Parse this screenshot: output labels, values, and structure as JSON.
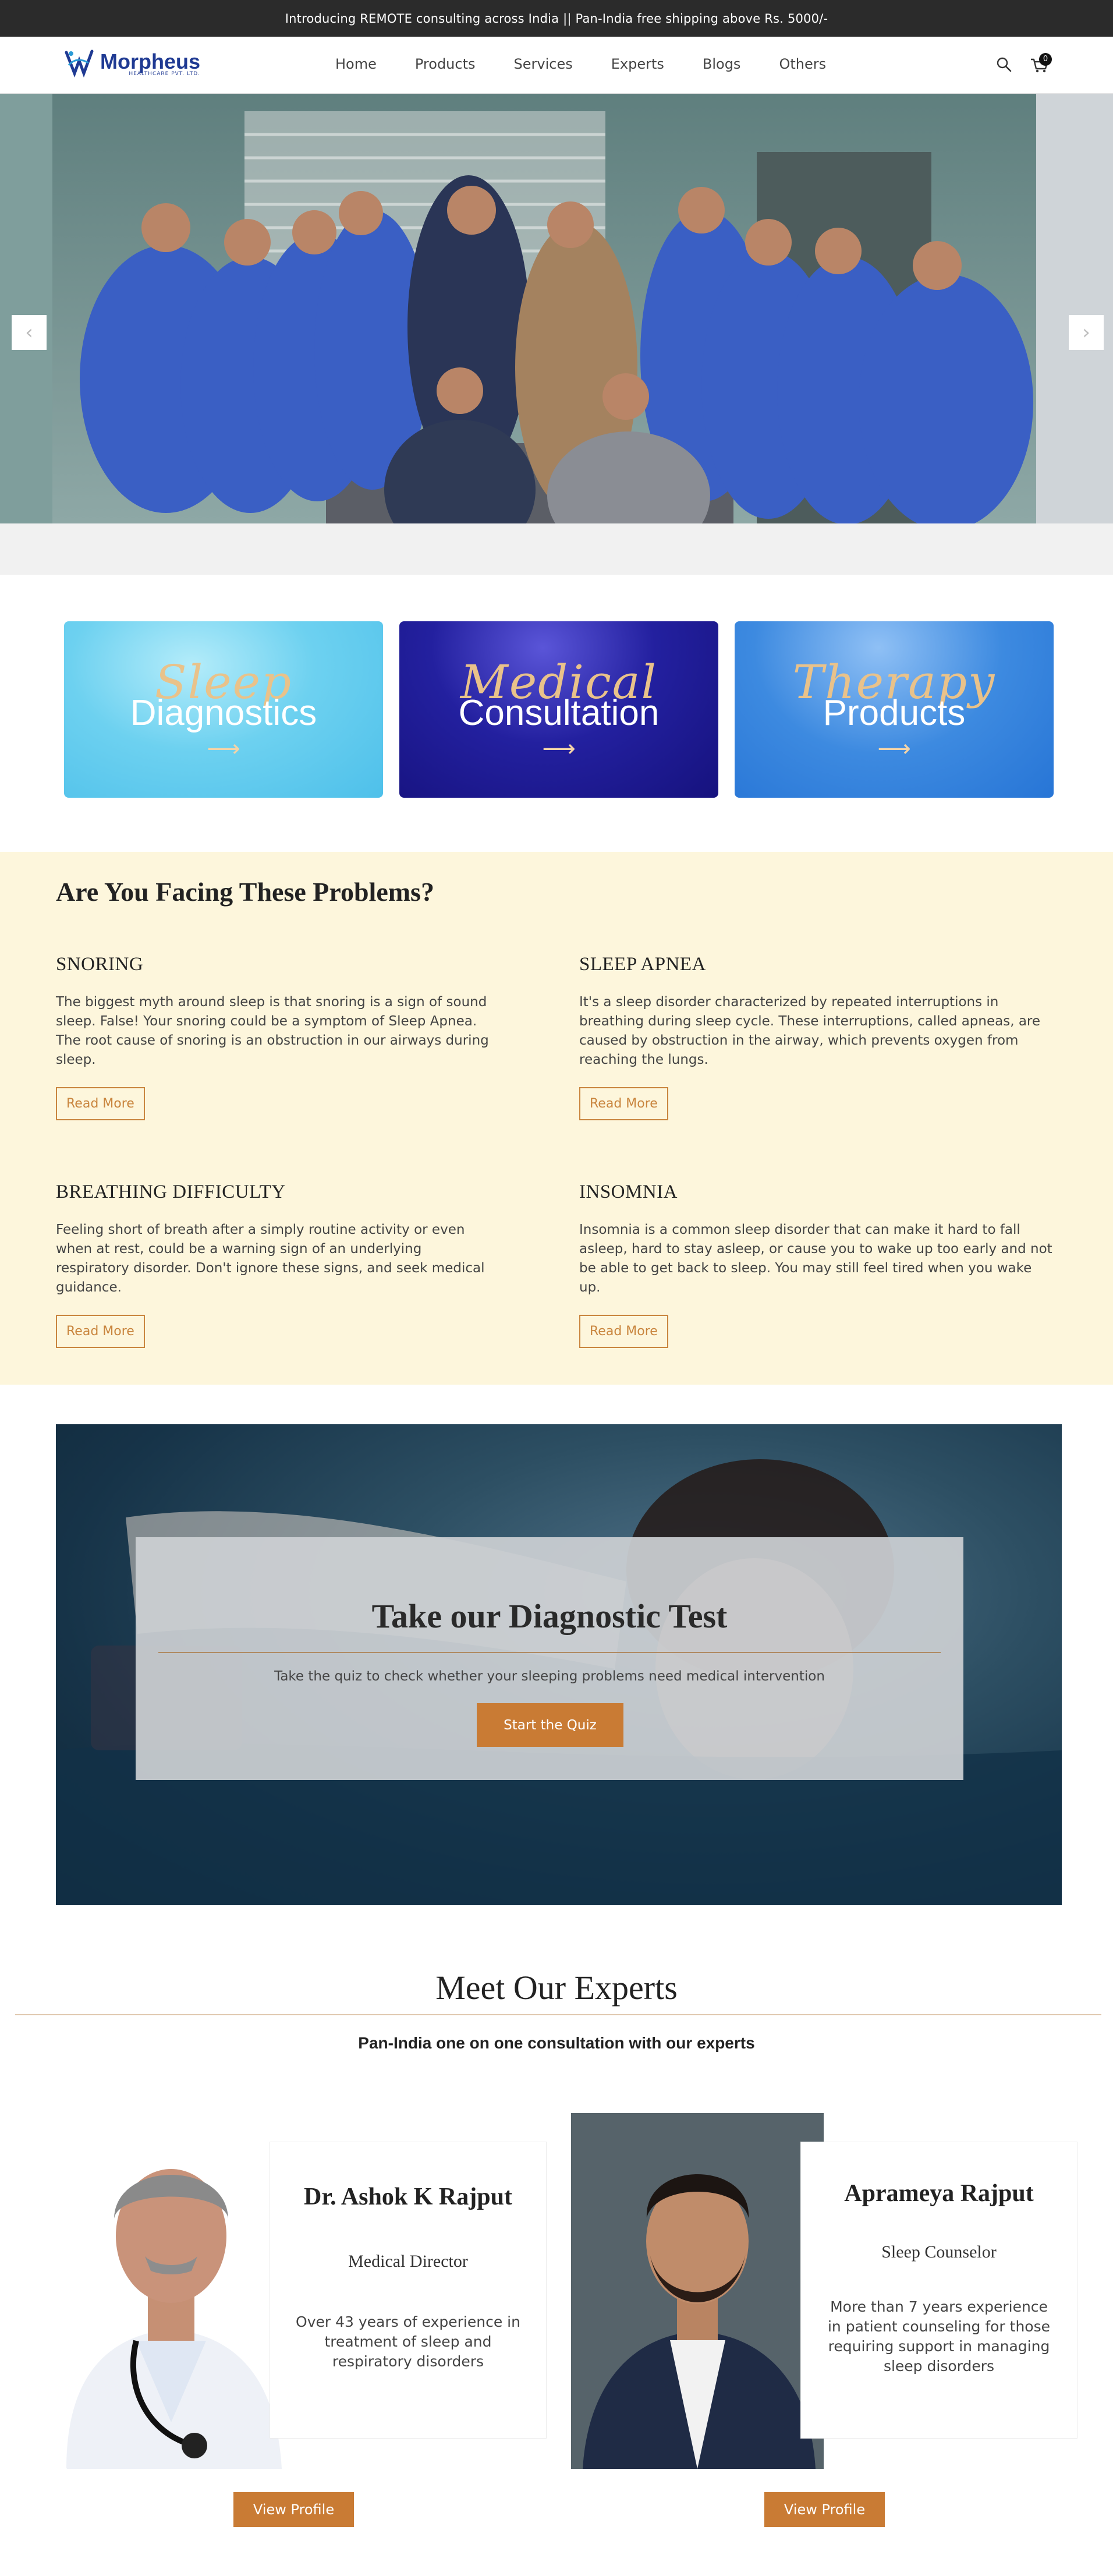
{
  "announcement": "Introducing REMOTE consulting across India || Pan-India free shipping above Rs. 5000/-",
  "brand": {
    "name": "Morpheus",
    "tagline": "HEALTHCARE PVT. LTD."
  },
  "nav": [
    "Home",
    "Products",
    "Services",
    "Experts",
    "Blogs",
    "Others"
  ],
  "cart_count": "0",
  "hero": {
    "prev": "‹",
    "next": "›"
  },
  "services": [
    {
      "script": "Sleep",
      "plain": "Diagnostics",
      "arrow": "⟶"
    },
    {
      "script": "Medical",
      "plain": "Consultation",
      "arrow": "⟶"
    },
    {
      "script": "Therapy",
      "plain": "Products",
      "arrow": "⟶"
    }
  ],
  "problems": {
    "title": "Are You Facing These Problems?",
    "items": [
      {
        "heading": "SNORING",
        "text": "The biggest myth around sleep is that snoring is a sign of sound sleep. False! Your snoring could be a symptom of Sleep Apnea. The root cause of snoring is an obstruction in our airways during sleep.",
        "button": "Read More"
      },
      {
        "heading": "SLEEP APNEA",
        "text": "It's a sleep disorder characterized by repeated interruptions in breathing during sleep cycle. These interruptions, called apneas, are caused by obstruction in the airway, which prevents oxygen from reaching the lungs.",
        "button": "Read More"
      },
      {
        "heading": "BREATHING DIFFICULTY",
        "text": "Feeling short of breath after a simply routine activity or even when at rest, could be a warning sign of an underlying respiratory disorder. Don't ignore these signs, and seek medical guidance.",
        "button": "Read More"
      },
      {
        "heading": "INSOMNIA",
        "text": "Insomnia is a common sleep disorder that can make it hard to fall asleep, hard to stay asleep, or cause you to wake up too early and not be able to get back to sleep. You may still feel tired when you wake up.",
        "button": "Read More"
      }
    ]
  },
  "diagnostic": {
    "title": "Take our Diagnostic Test",
    "subtitle": "Take the quiz to check whether your sleeping problems need medical intervention",
    "button": "Start the Quiz"
  },
  "experts": {
    "title": "Meet Our Experts",
    "subtitle": "Pan-India one on one consultation with our experts",
    "people": [
      {
        "name": "Dr. Ashok K Rajput",
        "role": "Medical Director",
        "desc": "Over 43 years of experience in treatment of sleep and respiratory disorders",
        "button": "View Profile"
      },
      {
        "name": "Aprameya Rajput",
        "role": "Sleep Counselor",
        "desc": "More than 7 years experience in patient counseling for those requiring support in managing sleep disorders",
        "button": "View Profile"
      }
    ]
  },
  "colors": {
    "accent": "#c97b34",
    "brand": "#1f3a93",
    "cream": "#fdf6dc",
    "topbar": "#2b2b2b"
  }
}
